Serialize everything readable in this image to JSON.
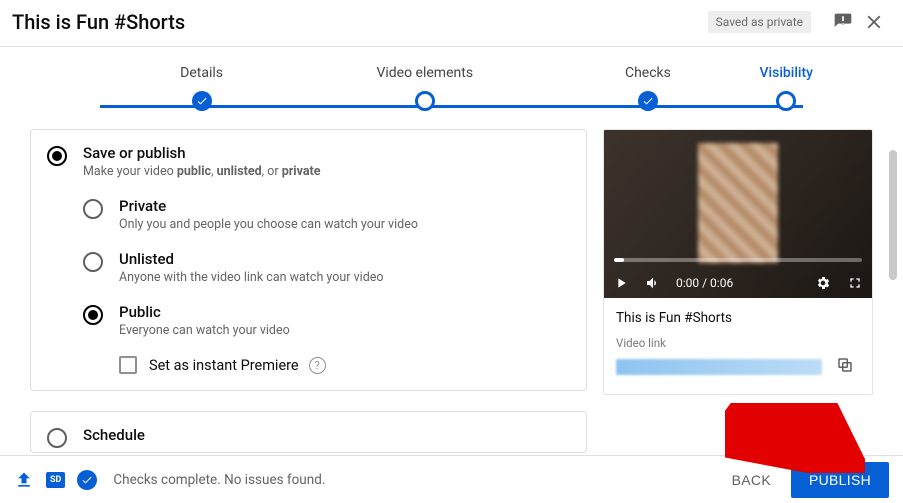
{
  "header": {
    "title": "This is Fun #Shorts",
    "saved_badge": "Saved as private"
  },
  "stepper": {
    "steps": [
      {
        "label": "Details",
        "state": "check"
      },
      {
        "label": "Video elements",
        "state": "hollow"
      },
      {
        "label": "Checks",
        "state": "check"
      },
      {
        "label": "Visibility",
        "state": "hollow",
        "active": true
      }
    ]
  },
  "visibility": {
    "save_or_publish": {
      "title": "Save or publish",
      "desc_prefix": "Make your video ",
      "desc_bold1": "public",
      "desc_mid1": ", ",
      "desc_bold2": "unlisted",
      "desc_mid2": ", or ",
      "desc_bold3": "private",
      "options": {
        "private": {
          "title": "Private",
          "desc": "Only you and people you choose can watch your video"
        },
        "unlisted": {
          "title": "Unlisted",
          "desc": "Anyone with the video link can watch your video"
        },
        "public": {
          "title": "Public",
          "desc": "Everyone can watch your video"
        }
      },
      "premiere_label": "Set as instant Premiere"
    },
    "schedule": {
      "title": "Schedule"
    }
  },
  "preview": {
    "time": "0:00 / 0:06",
    "title": "This is Fun #Shorts",
    "link_label": "Video link"
  },
  "footer": {
    "sd_badge": "SD",
    "status": "Checks complete. No issues found.",
    "back": "BACK",
    "publish": "PUBLISH"
  }
}
